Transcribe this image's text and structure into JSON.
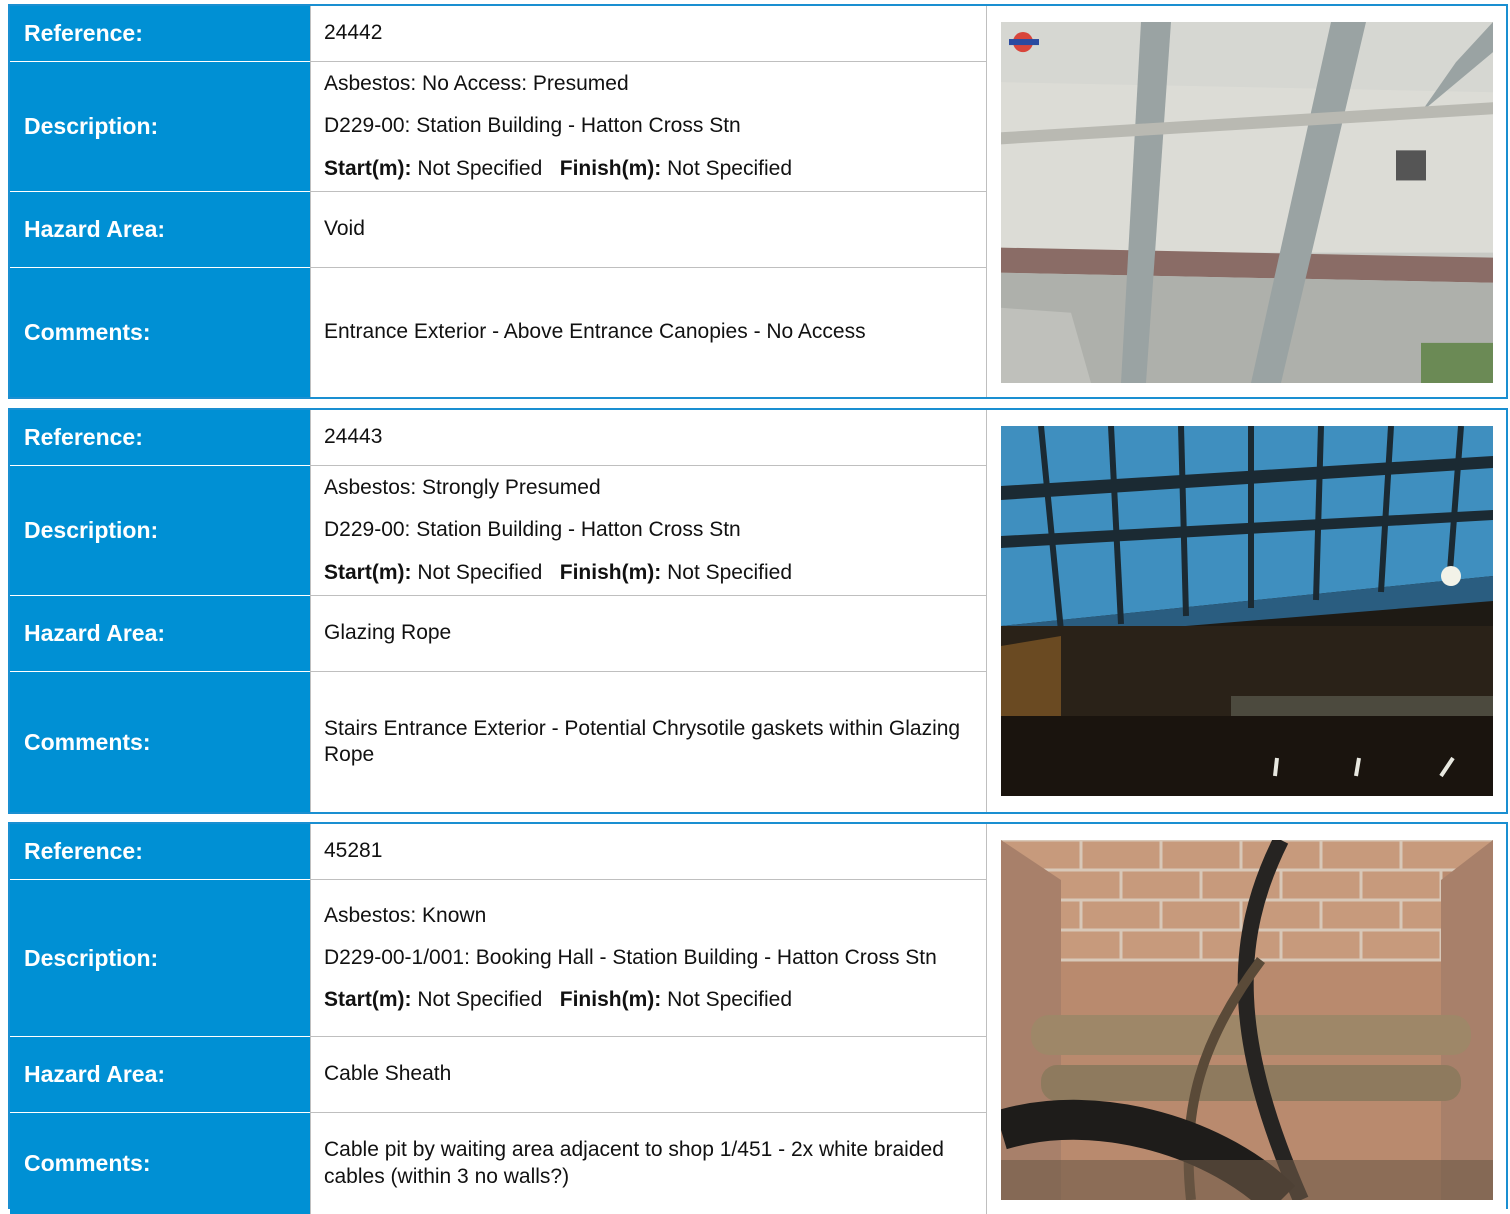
{
  "labels": {
    "reference": "Reference:",
    "description": "Description:",
    "hazard_area": "Hazard Area:",
    "comments": "Comments:",
    "start": "Start(m):",
    "finish": "Finish(m):"
  },
  "records": [
    {
      "reference": "24442",
      "status": "Asbestos: No Access: Presumed",
      "location": "D229-00: Station Building - Hatton Cross Stn",
      "start": "Not Specified",
      "finish": "Not Specified",
      "hazard_area": "Void",
      "comments": "Entrance Exterior - Above Entrance Canopies - No Access",
      "photo_icon": "canopy-ceiling-photo"
    },
    {
      "reference": "24443",
      "status": "Asbestos: Strongly Presumed",
      "location": "D229-00: Station Building - Hatton Cross Stn",
      "start": "Not Specified",
      "finish": "Not Specified",
      "hazard_area": "Glazing Rope",
      "comments": "Stairs Entrance Exterior - Potential Chrysotile gaskets within Glazing Rope",
      "photo_icon": "glazed-roof-photo"
    },
    {
      "reference": "45281",
      "status": "Asbestos: Known",
      "location": "D229-00-1/001: Booking Hall - Station Building - Hatton Cross Stn",
      "start": "Not Specified",
      "finish": "Not Specified",
      "hazard_area": "Cable Sheath",
      "comments": "Cable pit by waiting area adjacent to shop 1/451 - 2x white braided cables (within 3 no walls?)",
      "photo_icon": "cable-pit-photo"
    }
  ],
  "colors": {
    "label_bg": "#0090d4",
    "label_text": "#ffffff",
    "border": "#1a8fd1"
  }
}
